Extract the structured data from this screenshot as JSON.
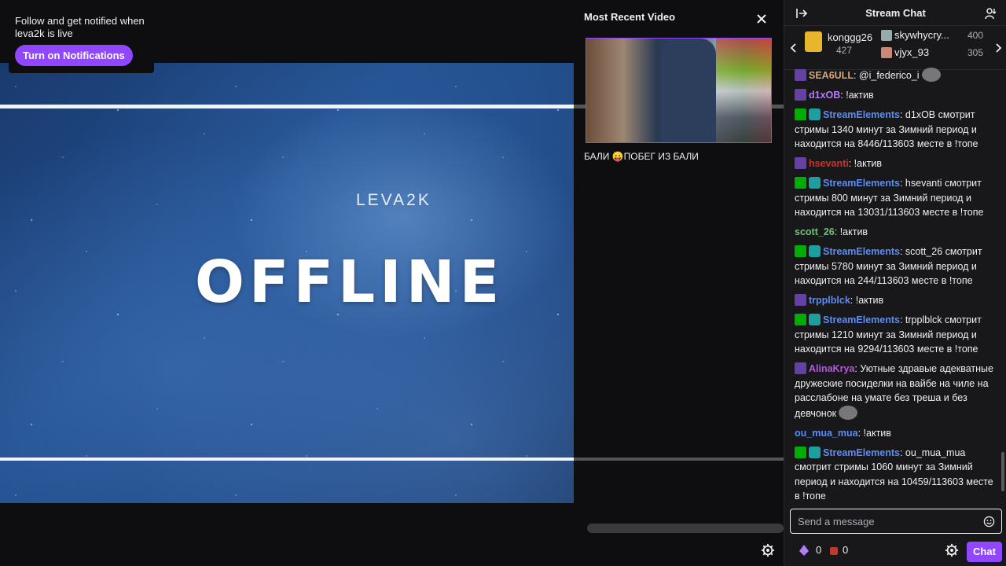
{
  "notification": {
    "text": "Follow and get notified when leva2k is live",
    "button_label": "Turn on Notifications"
  },
  "offline_banner": {
    "channel_name": "LEVA2K",
    "status_text": "OFFLINE"
  },
  "recent_video": {
    "heading": "Most Recent Video",
    "caption": "БАЛИ 😛ПОБЕГ ИЗ БАЛИ"
  },
  "chat": {
    "title": "Stream Chat",
    "leaderboard": [
      {
        "name": "konggg26",
        "count": "427"
      },
      {
        "name": "skywhycry...",
        "count": "400"
      },
      {
        "name": "vjyx_93",
        "count": "305"
      }
    ],
    "messages": [
      {
        "badges": [
          "user"
        ],
        "name": "SEA6ULL",
        "color": "#d2a679",
        "text": "@i_federico_i",
        "emote": true
      },
      {
        "badges": [
          "user"
        ],
        "name": "d1xOB",
        "color": "#b57cf7",
        "text": "!актив"
      },
      {
        "badges": [
          "mod",
          "bot"
        ],
        "name": "StreamElements",
        "color": "#5c8df5",
        "text": "d1xOB смотрит стримы 1340 минут за Зимний период и находится на 8446/113603 месте в !топе"
      },
      {
        "badges": [
          "user"
        ],
        "name": "hsevanti",
        "color": "#d0312d",
        "text": "!актив"
      },
      {
        "badges": [
          "mod",
          "bot"
        ],
        "name": "StreamElements",
        "color": "#5c8df5",
        "text": "hsevanti смотрит стримы 800 минут за Зимний период и находится на 13031/113603 месте в !топе"
      },
      {
        "badges": [],
        "name": "scott_26",
        "color": "#74c07a",
        "text": "!актив"
      },
      {
        "badges": [
          "mod",
          "bot"
        ],
        "name": "StreamElements",
        "color": "#5c8df5",
        "text": "scott_26 смотрит стримы 5780 минут за Зимний период и находится на 244/113603 месте в !топе"
      },
      {
        "badges": [
          "user"
        ],
        "name": "trpplblck",
        "color": "#5c8df5",
        "text": "!актив"
      },
      {
        "badges": [
          "mod",
          "bot"
        ],
        "name": "StreamElements",
        "color": "#5c8df5",
        "text": "trpplblck смотрит стримы 1210 минут за Зимний период и находится на 9294/113603 месте в !топе"
      },
      {
        "badges": [
          "user"
        ],
        "name": "AlinaKrya",
        "color": "#b05cd6",
        "text": "Уютные здравые адекватные дружеские посиделки на вайбе на чиле на расслабоне на умате без треша и без девчонок",
        "emote": true
      },
      {
        "badges": [],
        "name": "ou_mua_mua",
        "color": "#5c8df5",
        "text": "!актив"
      },
      {
        "badges": [
          "mod",
          "bot"
        ],
        "name": "StreamElements",
        "color": "#5c8df5",
        "text": "ou_mua_mua смотрит стримы 1060 минут за Зимний период и находится на 10459/113603 месте в !топе"
      }
    ],
    "input_placeholder": "Send a message",
    "bits_count": "0",
    "points_count": "0",
    "chat_button": "Chat"
  },
  "colors": {
    "accent": "#9147ff",
    "background": "#0e0e10",
    "chat_bg": "#18181b"
  }
}
